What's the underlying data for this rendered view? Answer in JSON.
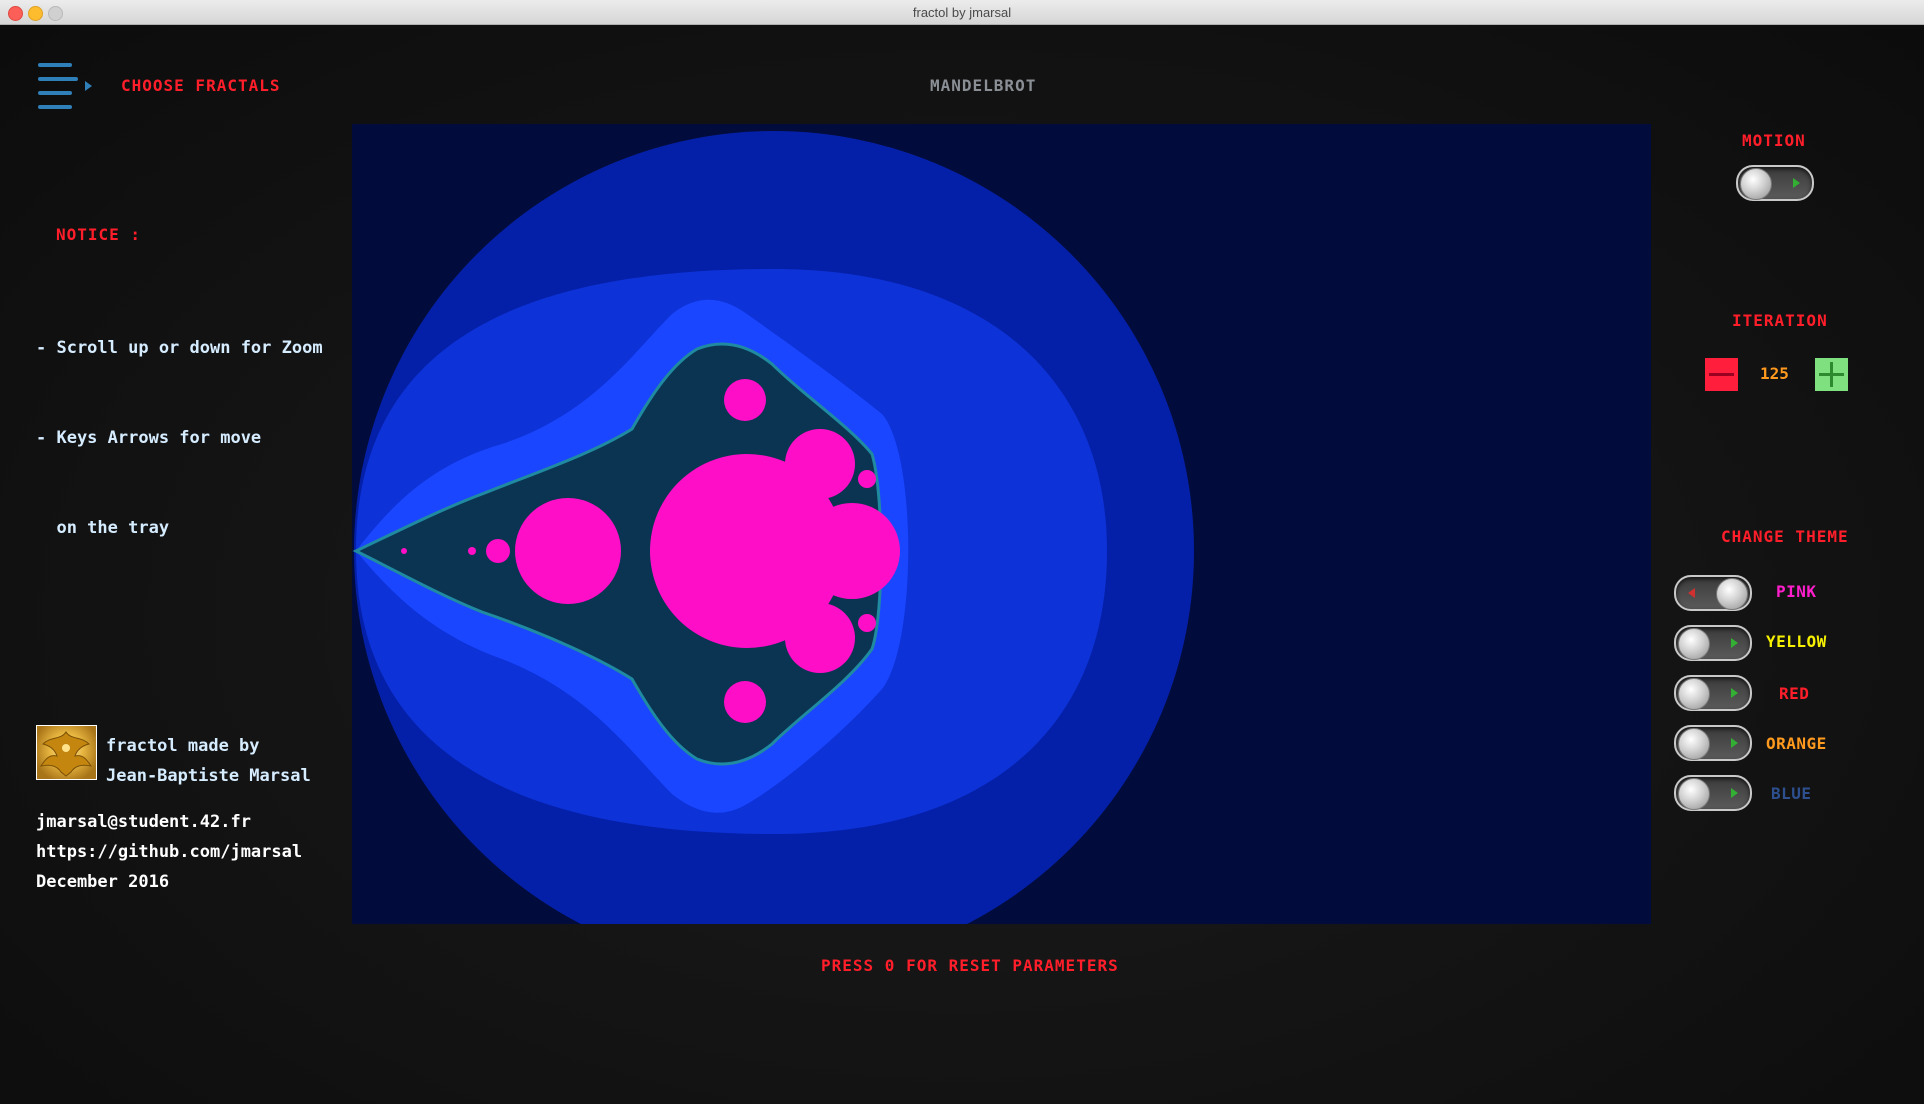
{
  "window": {
    "title": "fractol by jmarsal"
  },
  "header": {
    "choose_label": "CHOOSE FRACTALS",
    "fractal_name": "MANDELBROT"
  },
  "notice": {
    "title": "NOTICE :",
    "lines": [
      "- Scroll up or down for Zoom",
      "- Keys Arrows for move",
      "  on the tray"
    ]
  },
  "controls": {
    "motion_label": "MOTION",
    "motion_on": false,
    "iteration_label": "ITERATION",
    "iteration_value": "125",
    "change_theme_label": "CHANGE THEME",
    "themes": [
      {
        "name": "PINK",
        "color": "#ff1ecc",
        "active": true
      },
      {
        "name": "YELLOW",
        "color": "#f4f000",
        "active": false
      },
      {
        "name": "RED",
        "color": "#ff1e2a",
        "active": false
      },
      {
        "name": "ORANGE",
        "color": "#ff9a1e",
        "active": false
      },
      {
        "name": "BLUE",
        "color": "#2d4f8e",
        "active": false
      }
    ]
  },
  "credits": {
    "line1": "fractol made by",
    "line2": "Jean-Baptiste Marsal",
    "email": "jmarsal@student.42.fr",
    "github": "https://github.com/jmarsal",
    "date": "December 2016"
  },
  "footer": {
    "reset_label": "PRESS 0 FOR RESET PARAMETERS"
  },
  "colors": {
    "accent_red": "#ff1e2a",
    "menu_blue": "#2f7fb8",
    "fractal_pink": "#ff0ec8",
    "canvas_bg": "#020c3c"
  }
}
